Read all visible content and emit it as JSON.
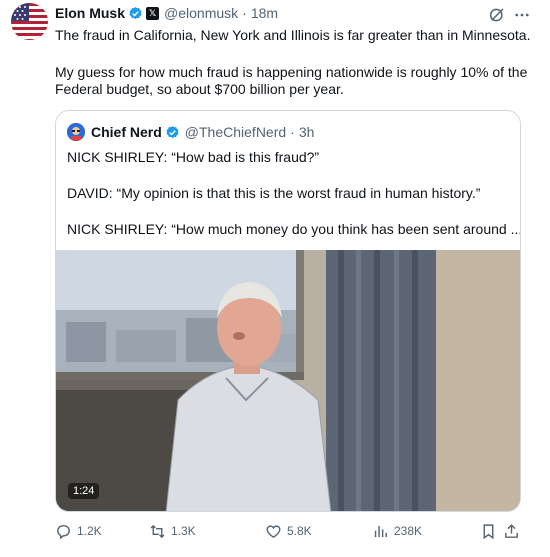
{
  "tweet": {
    "author_name": "Elon Musk",
    "handle": "@elonmusk",
    "separator": "·",
    "time": "18m",
    "line1": "The fraud in California, New York and Illinois is far greater than in Minnesota.",
    "line2": "My guess for how much fraud is happening nationwide is roughly 10% of the",
    "line3": "Federal budget, so about $700 billion per year."
  },
  "quote": {
    "author_name": "Chief Nerd",
    "handle": "@TheChiefNerd",
    "separator": "·",
    "time": "3h",
    "line1": "NICK SHIRLEY: “How bad is this fraud?”",
    "line2": "DAVID: “My opinion is that this is the worst fraud in human history.”",
    "line3": "NICK SHIRLEY: “How much money do you think has been sent around ...",
    "video_duration": "1:24"
  },
  "actions": {
    "replies": "1.2K",
    "reposts": "1.3K",
    "likes": "5.8K",
    "views": "238K"
  },
  "icons": {
    "verified": "verified-badge-icon",
    "x_affiliate": "x-logo-icon",
    "grok": "grok-icon",
    "more": "more-icon",
    "reply": "reply-icon",
    "repost": "repost-icon",
    "like": "heart-icon",
    "views": "views-icon",
    "bookmark": "bookmark-icon",
    "share": "share-icon"
  },
  "colors": {
    "verified_blue": "#1d9bf0",
    "text_primary": "#0f1419",
    "text_secondary": "#536471",
    "border": "#cfd9de"
  }
}
